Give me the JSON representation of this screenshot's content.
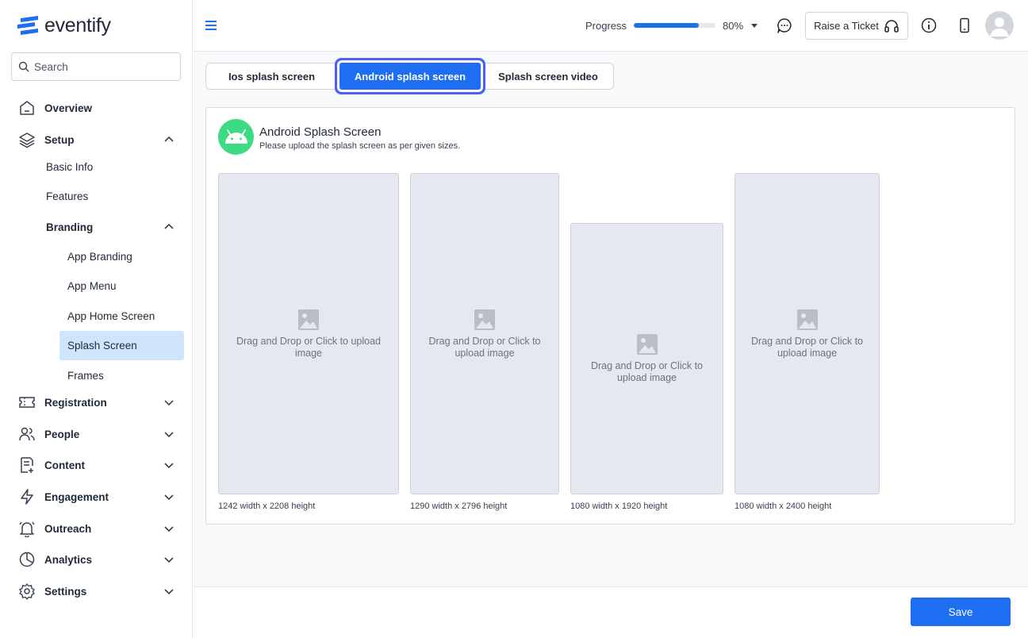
{
  "app": {
    "logo_text": "eventify"
  },
  "search": {
    "placeholder": "Search"
  },
  "sidebar": {
    "overview": "Overview",
    "setup": "Setup",
    "setup_items": {
      "basic_info": "Basic Info",
      "features": "Features",
      "branding": "Branding"
    },
    "branding_items": {
      "app_branding": "App Branding",
      "app_menu": "App Menu",
      "app_home_screen": "App Home Screen",
      "splash_screen": "Splash Screen",
      "frames": "Frames"
    },
    "registration": "Registration",
    "people": "People",
    "content": "Content",
    "engagement": "Engagement",
    "outreach": "Outreach",
    "analytics": "Analytics",
    "settings": "Settings"
  },
  "header": {
    "progress_label": "Progress",
    "progress_value": 80,
    "progress_text": "80%",
    "ticket_label": "Raise a Ticket"
  },
  "tabs": {
    "ios": "Ios splash screen",
    "android": "Android splash screen",
    "video": "Splash screen video"
  },
  "card": {
    "title": "Android Splash Screen",
    "subtitle": "Please upload the splash screen as per given sizes.",
    "upload_text": "Drag and Drop or Click to upload image",
    "slots": [
      {
        "caption": "1242 width x 2208 height"
      },
      {
        "caption": "1290 width x 2796 height"
      },
      {
        "caption": "1080 width x 1920 height"
      },
      {
        "caption": "1080 width x 2400 height"
      }
    ]
  },
  "footer": {
    "save_label": "Save"
  },
  "colors": {
    "accent": "#1d6ef0",
    "android_green": "#3ddc84",
    "active_nav": "#cfe5fb"
  }
}
